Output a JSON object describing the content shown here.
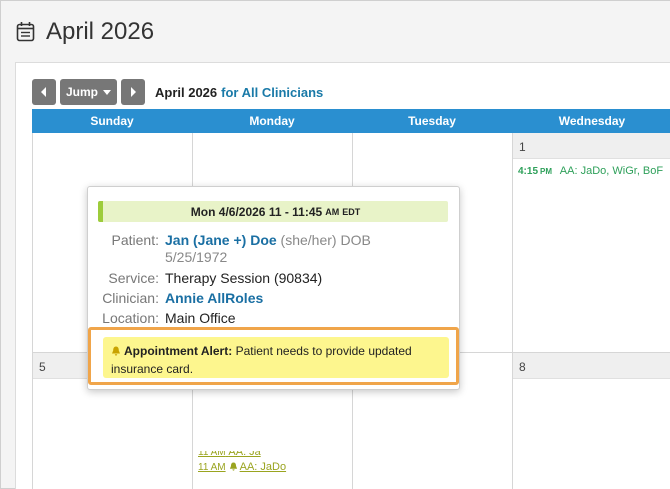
{
  "page": {
    "title": "April 2026"
  },
  "toolbar": {
    "prev_label": "◀",
    "jump_label": "Jump",
    "next_label": "▶",
    "month_label": "April 2026",
    "scope_label": "for All Clinicians"
  },
  "calendar": {
    "weekdays": [
      "Sunday",
      "Monday",
      "Tuesday",
      "Wednesday"
    ],
    "dates": {
      "wed_week1": "1",
      "sun_week2": "5",
      "wed_week2": "8"
    },
    "events": {
      "wed1": {
        "time": "4:15",
        "ampm": "PM",
        "text": "AA: JaDo, WiGr, BoF"
      },
      "mon6_partial": {
        "time": "11 AM",
        "text": "AA: Ja"
      },
      "mon6": {
        "time": "11 AM",
        "text": "AA: JaDo"
      }
    }
  },
  "popover": {
    "header_main": "Mon 4/6/2026 11 - 11:45",
    "header_am": "AM",
    "header_tz": "EDT",
    "patient_label": "Patient:",
    "patient_name": "Jan (Jane +) Doe",
    "patient_pronouns": "(she/her) DOB",
    "patient_dob": "5/25/1972",
    "service_label": "Service:",
    "service_value": "Therapy Session (90834)",
    "clinician_label": "Clinician:",
    "clinician_value": "Annie AllRoles",
    "location_label": "Location:",
    "location_value": "Main Office",
    "alert_title": "Appointment Alert:",
    "alert_text": "Patient needs to provide updated insurance card."
  },
  "colors": {
    "header_blue": "#2a8fd0",
    "link_blue": "#1a6fa3",
    "event_green": "#2ea05a",
    "alert_yellow": "#fdf68e",
    "alert_border": "#f0a54a",
    "popover_header": "#e8f3c8"
  },
  "icons": {
    "page_calendar": "calendar-icon",
    "alert_bell": "bell-icon",
    "jump_caret": "caret-down-icon"
  }
}
